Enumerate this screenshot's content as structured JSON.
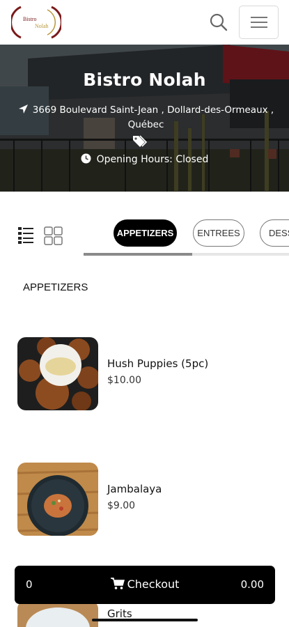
{
  "header": {
    "logo_text_top": "Bistro",
    "logo_text_bottom": "Nolah",
    "search_icon": "search-icon",
    "menu_icon": "hamburger-menu-icon"
  },
  "hero": {
    "title": "Bistro Nolah",
    "address": "3669 Boulevard Saint-Jean , Dollard-des-Ormeaux , Québec",
    "hours": "Opening Hours: Closed",
    "icons": [
      "location-arrow-icon",
      "tags-icon",
      "clock-icon"
    ]
  },
  "view_toggle": {
    "list_icon": "list-view-icon",
    "grid_icon": "grid-view-icon"
  },
  "categories": {
    "tabs": [
      "APPETIZERS",
      "ENTREES",
      "DESS"
    ],
    "active_index": 0,
    "scroll_fraction": 0.53
  },
  "section": {
    "heading": "APPETIZERS"
  },
  "items": [
    {
      "name": "Hush Puppies (5pc)",
      "price": "$10.00"
    },
    {
      "name": "Jambalaya",
      "price": "$9.00"
    },
    {
      "name": "Grits",
      "price": ""
    }
  ],
  "checkout": {
    "count": "0",
    "label": "Checkout",
    "total": "0.00",
    "icon": "shopping-cart-icon"
  },
  "colors": {
    "accent": "#000000",
    "logo_red": "#7a1a1a",
    "logo_gold": "#b8963a"
  }
}
